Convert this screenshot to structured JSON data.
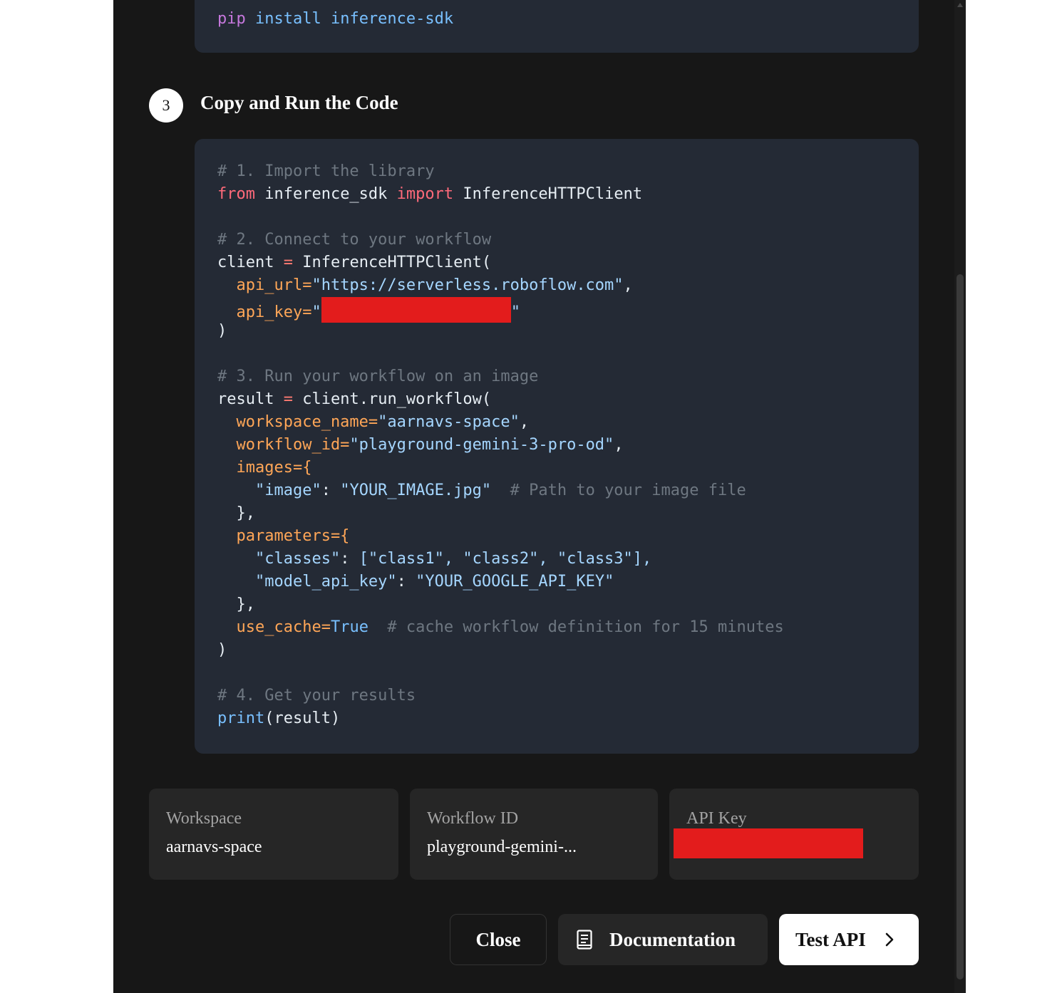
{
  "install": {
    "cmd": "pip",
    "args": " install inference-sdk"
  },
  "step": {
    "number": "3",
    "title": "Copy and Run the Code"
  },
  "code": {
    "c1": "# 1. Import the library",
    "from_kw": "from",
    "module": " inference_sdk ",
    "import_kw": "import",
    "class_name": " InferenceHTTPClient",
    "c2": "# 2. Connect to your workflow",
    "client_var": "client",
    "eq": " = ",
    "client_ctor": "InferenceHTTPClient(",
    "api_url_arg": "  api_url=",
    "api_url_val": "\"https://serverless.roboflow.com\"",
    "comma": ",",
    "api_key_arg": "  api_key=",
    "quote": "\"",
    "close_paren": ")",
    "c3": "# 3. Run your workflow on an image",
    "result_var": "result",
    "run_call": "client.run_workflow(",
    "ws_arg": "  workspace_name=",
    "ws_val": "\"aarnavs-space\"",
    "wf_arg": "  workflow_id=",
    "wf_val": "\"playground-gemini-3-pro-od\"",
    "images_arg": "  images={",
    "image_key": "    \"image\"",
    "colon": ": ",
    "image_val": "\"YOUR_IMAGE.jpg\"",
    "image_comment": "  # Path to your image file",
    "close_brace": "  },",
    "params_arg": "  parameters={",
    "classes_key": "    \"classes\"",
    "classes_val": "[\"class1\", \"class2\", \"class3\"],",
    "model_key": "    \"model_api_key\"",
    "model_val": "\"YOUR_GOOGLE_API_KEY\"",
    "cache_arg": "  use_cache=",
    "cache_val": "True",
    "cache_comment": "  # cache workflow definition for 15 minutes",
    "c4": "# 4. Get your results",
    "print_fn": "print",
    "print_args": "(result)"
  },
  "info": {
    "workspace_label": "Workspace",
    "workspace_value": "aarnavs-space",
    "workflow_label": "Workflow ID",
    "workflow_value": "playground-gemini-...",
    "api_key_label": "API Key"
  },
  "buttons": {
    "close": "Close",
    "documentation": "Documentation",
    "test_api": "Test API",
    "documentation_icon": "document-icon",
    "test_api_icon": "chevron-right-icon"
  },
  "colors": {
    "modal_bg": "#171717",
    "code_bg": "#242a35",
    "card_bg": "#262626",
    "redaction": "#e31c1c"
  }
}
